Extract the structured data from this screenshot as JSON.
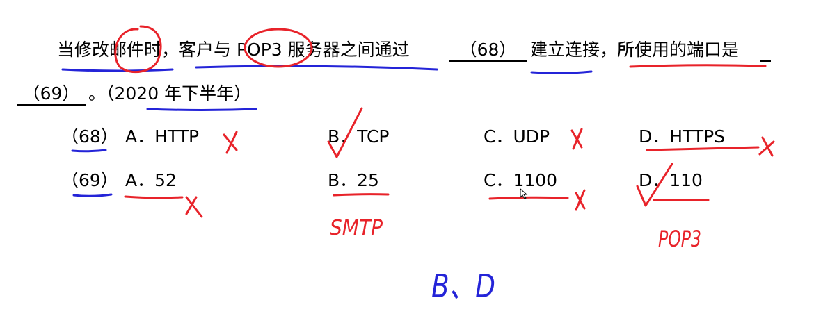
{
  "question": {
    "line1_prefix": "当修改邮件时，客户与 POP3 服务器之间通过",
    "blank1": "（68）",
    "line1_middle": "建立连接，所使用的端口是",
    "blank2": "（69）",
    "line2_suffix": "。（2020 年下半年）"
  },
  "q68": {
    "number": "（68）",
    "options": [
      "A．HTTP",
      "B．TCP",
      "C．UDP",
      "D．HTTPS"
    ]
  },
  "q69": {
    "number": "（69）",
    "options": [
      "A．52",
      "B．25",
      "C．1100",
      "D．110"
    ]
  },
  "annotations": {
    "smtp_note": "SMTP",
    "pop3_note": "POP3",
    "answer": "B、D",
    "red": "#e8232a",
    "blue": "#2424d8"
  }
}
